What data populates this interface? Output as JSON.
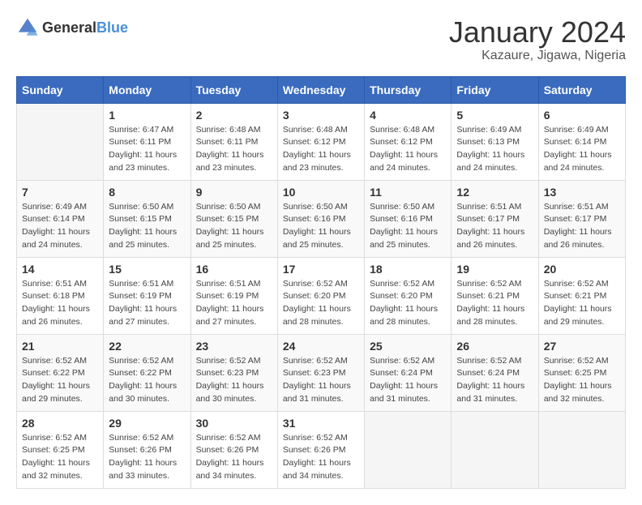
{
  "app": {
    "name_general": "General",
    "name_blue": "Blue"
  },
  "calendar": {
    "title": "January 2024",
    "subtitle": "Kazaure, Jigawa, Nigeria"
  },
  "headers": [
    "Sunday",
    "Monday",
    "Tuesday",
    "Wednesday",
    "Thursday",
    "Friday",
    "Saturday"
  ],
  "weeks": [
    [
      {
        "day": "",
        "sunrise": "",
        "sunset": "",
        "daylight": ""
      },
      {
        "day": "1",
        "sunrise": "Sunrise: 6:47 AM",
        "sunset": "Sunset: 6:11 PM",
        "daylight": "Daylight: 11 hours and 23 minutes."
      },
      {
        "day": "2",
        "sunrise": "Sunrise: 6:48 AM",
        "sunset": "Sunset: 6:11 PM",
        "daylight": "Daylight: 11 hours and 23 minutes."
      },
      {
        "day": "3",
        "sunrise": "Sunrise: 6:48 AM",
        "sunset": "Sunset: 6:12 PM",
        "daylight": "Daylight: 11 hours and 23 minutes."
      },
      {
        "day": "4",
        "sunrise": "Sunrise: 6:48 AM",
        "sunset": "Sunset: 6:12 PM",
        "daylight": "Daylight: 11 hours and 24 minutes."
      },
      {
        "day": "5",
        "sunrise": "Sunrise: 6:49 AM",
        "sunset": "Sunset: 6:13 PM",
        "daylight": "Daylight: 11 hours and 24 minutes."
      },
      {
        "day": "6",
        "sunrise": "Sunrise: 6:49 AM",
        "sunset": "Sunset: 6:14 PM",
        "daylight": "Daylight: 11 hours and 24 minutes."
      }
    ],
    [
      {
        "day": "7",
        "sunrise": "Sunrise: 6:49 AM",
        "sunset": "Sunset: 6:14 PM",
        "daylight": "Daylight: 11 hours and 24 minutes."
      },
      {
        "day": "8",
        "sunrise": "Sunrise: 6:50 AM",
        "sunset": "Sunset: 6:15 PM",
        "daylight": "Daylight: 11 hours and 25 minutes."
      },
      {
        "day": "9",
        "sunrise": "Sunrise: 6:50 AM",
        "sunset": "Sunset: 6:15 PM",
        "daylight": "Daylight: 11 hours and 25 minutes."
      },
      {
        "day": "10",
        "sunrise": "Sunrise: 6:50 AM",
        "sunset": "Sunset: 6:16 PM",
        "daylight": "Daylight: 11 hours and 25 minutes."
      },
      {
        "day": "11",
        "sunrise": "Sunrise: 6:50 AM",
        "sunset": "Sunset: 6:16 PM",
        "daylight": "Daylight: 11 hours and 25 minutes."
      },
      {
        "day": "12",
        "sunrise": "Sunrise: 6:51 AM",
        "sunset": "Sunset: 6:17 PM",
        "daylight": "Daylight: 11 hours and 26 minutes."
      },
      {
        "day": "13",
        "sunrise": "Sunrise: 6:51 AM",
        "sunset": "Sunset: 6:17 PM",
        "daylight": "Daylight: 11 hours and 26 minutes."
      }
    ],
    [
      {
        "day": "14",
        "sunrise": "Sunrise: 6:51 AM",
        "sunset": "Sunset: 6:18 PM",
        "daylight": "Daylight: 11 hours and 26 minutes."
      },
      {
        "day": "15",
        "sunrise": "Sunrise: 6:51 AM",
        "sunset": "Sunset: 6:19 PM",
        "daylight": "Daylight: 11 hours and 27 minutes."
      },
      {
        "day": "16",
        "sunrise": "Sunrise: 6:51 AM",
        "sunset": "Sunset: 6:19 PM",
        "daylight": "Daylight: 11 hours and 27 minutes."
      },
      {
        "day": "17",
        "sunrise": "Sunrise: 6:52 AM",
        "sunset": "Sunset: 6:20 PM",
        "daylight": "Daylight: 11 hours and 28 minutes."
      },
      {
        "day": "18",
        "sunrise": "Sunrise: 6:52 AM",
        "sunset": "Sunset: 6:20 PM",
        "daylight": "Daylight: 11 hours and 28 minutes."
      },
      {
        "day": "19",
        "sunrise": "Sunrise: 6:52 AM",
        "sunset": "Sunset: 6:21 PM",
        "daylight": "Daylight: 11 hours and 28 minutes."
      },
      {
        "day": "20",
        "sunrise": "Sunrise: 6:52 AM",
        "sunset": "Sunset: 6:21 PM",
        "daylight": "Daylight: 11 hours and 29 minutes."
      }
    ],
    [
      {
        "day": "21",
        "sunrise": "Sunrise: 6:52 AM",
        "sunset": "Sunset: 6:22 PM",
        "daylight": "Daylight: 11 hours and 29 minutes."
      },
      {
        "day": "22",
        "sunrise": "Sunrise: 6:52 AM",
        "sunset": "Sunset: 6:22 PM",
        "daylight": "Daylight: 11 hours and 30 minutes."
      },
      {
        "day": "23",
        "sunrise": "Sunrise: 6:52 AM",
        "sunset": "Sunset: 6:23 PM",
        "daylight": "Daylight: 11 hours and 30 minutes."
      },
      {
        "day": "24",
        "sunrise": "Sunrise: 6:52 AM",
        "sunset": "Sunset: 6:23 PM",
        "daylight": "Daylight: 11 hours and 31 minutes."
      },
      {
        "day": "25",
        "sunrise": "Sunrise: 6:52 AM",
        "sunset": "Sunset: 6:24 PM",
        "daylight": "Daylight: 11 hours and 31 minutes."
      },
      {
        "day": "26",
        "sunrise": "Sunrise: 6:52 AM",
        "sunset": "Sunset: 6:24 PM",
        "daylight": "Daylight: 11 hours and 31 minutes."
      },
      {
        "day": "27",
        "sunrise": "Sunrise: 6:52 AM",
        "sunset": "Sunset: 6:25 PM",
        "daylight": "Daylight: 11 hours and 32 minutes."
      }
    ],
    [
      {
        "day": "28",
        "sunrise": "Sunrise: 6:52 AM",
        "sunset": "Sunset: 6:25 PM",
        "daylight": "Daylight: 11 hours and 32 minutes."
      },
      {
        "day": "29",
        "sunrise": "Sunrise: 6:52 AM",
        "sunset": "Sunset: 6:26 PM",
        "daylight": "Daylight: 11 hours and 33 minutes."
      },
      {
        "day": "30",
        "sunrise": "Sunrise: 6:52 AM",
        "sunset": "Sunset: 6:26 PM",
        "daylight": "Daylight: 11 hours and 34 minutes."
      },
      {
        "day": "31",
        "sunrise": "Sunrise: 6:52 AM",
        "sunset": "Sunset: 6:26 PM",
        "daylight": "Daylight: 11 hours and 34 minutes."
      },
      {
        "day": "",
        "sunrise": "",
        "sunset": "",
        "daylight": ""
      },
      {
        "day": "",
        "sunrise": "",
        "sunset": "",
        "daylight": ""
      },
      {
        "day": "",
        "sunrise": "",
        "sunset": "",
        "daylight": ""
      }
    ]
  ]
}
